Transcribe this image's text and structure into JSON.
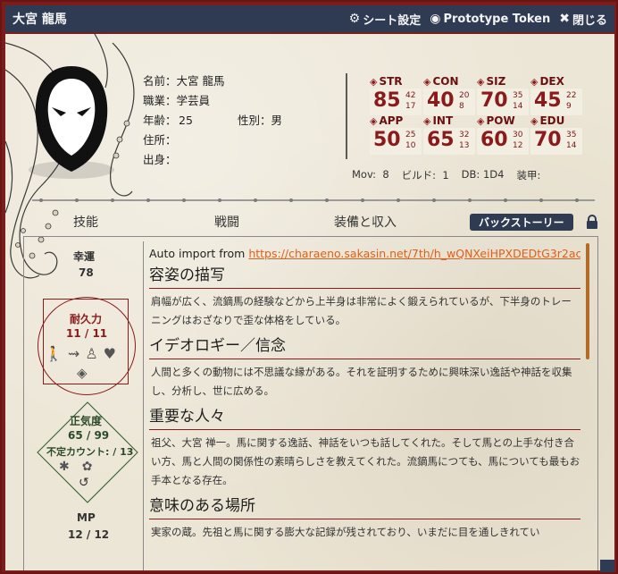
{
  "window": {
    "title": "大宮 龍馬"
  },
  "titlebar": {
    "sheet_settings": "シート設定",
    "prototype_token": "Prototype Token",
    "close": "閉じる"
  },
  "profile": {
    "name_label": "名前：",
    "name": "大宮 龍馬",
    "job_label": "職業：",
    "job": "学芸員",
    "age_label": "年齢：",
    "age": "25",
    "sex_label": "性別：",
    "sex": "男",
    "address_label": "住所：",
    "address": "",
    "origin_label": "出身：",
    "origin": ""
  },
  "stats": [
    {
      "name": "STR",
      "value": "85",
      "half": "42",
      "fifth": "17"
    },
    {
      "name": "CON",
      "value": "40",
      "half": "20",
      "fifth": "8"
    },
    {
      "name": "SIZ",
      "value": "70",
      "half": "35",
      "fifth": "14"
    },
    {
      "name": "DEX",
      "value": "45",
      "half": "22",
      "fifth": "9"
    },
    {
      "name": "APP",
      "value": "50",
      "half": "25",
      "fifth": "10"
    },
    {
      "name": "INT",
      "value": "65",
      "half": "32",
      "fifth": "13"
    },
    {
      "name": "POW",
      "value": "60",
      "half": "30",
      "fifth": "12"
    },
    {
      "name": "EDU",
      "value": "70",
      "half": "35",
      "fifth": "14"
    }
  ],
  "derived": {
    "mov_label": "Mov:",
    "mov": "8",
    "build_label": "ビルド:",
    "build": "1",
    "db_label": "DB:",
    "db": "1D4",
    "armor_label": "装甲:"
  },
  "tabs": [
    {
      "label": "技能"
    },
    {
      "label": "戦闘"
    },
    {
      "label": "装備と収入"
    },
    {
      "label": "バックストーリー"
    }
  ],
  "vitals": {
    "luck_label": "幸運",
    "luck": "78",
    "hp_label": "耐久力",
    "hp": "11 / 11",
    "san_label": "正気度",
    "san": "65 / 99",
    "indef_label": "不定カウント: / 13",
    "mp_label": "MP",
    "mp": "12 / 12"
  },
  "backstory": {
    "auto_import_label": "Auto import from",
    "auto_import_url": "https://charaeno.sakasin.net/7th/h_wQNXeiHPXDEDtG3r2ac",
    "sections": [
      {
        "title": "容姿の描写",
        "body": "肩幅が広く、流鏑馬の経験などから上半身は非常によく鍛えられているが、下半身のトレーニングはおざなりで歪な体格をしている。"
      },
      {
        "title": "イデオロギー／信念",
        "body": "人間と多くの動物には不思議な縁がある。それを証明するために興味深い逸話や神話を収集し、分析し、世に広める。"
      },
      {
        "title": "重要な人々",
        "body": "祖父、大宮 禅一。馬に関する逸話、神話をいつも話してくれた。そして馬との上手な付き合い方、馬と人間の関係性の素晴らしさを教えてくれた。流鏑馬につても、馬についても最もお手本となる存在。"
      },
      {
        "title": "意味のある場所",
        "body": "実家の蔵。先祖と馬に関する膨大な記録が残されており、いまだに目を通しきれてい"
      }
    ]
  },
  "colors": {
    "titlebar": "#2f3b52",
    "accent": "#8b1a1a",
    "link": "#e0601a",
    "frame": "#7a1d1d"
  }
}
